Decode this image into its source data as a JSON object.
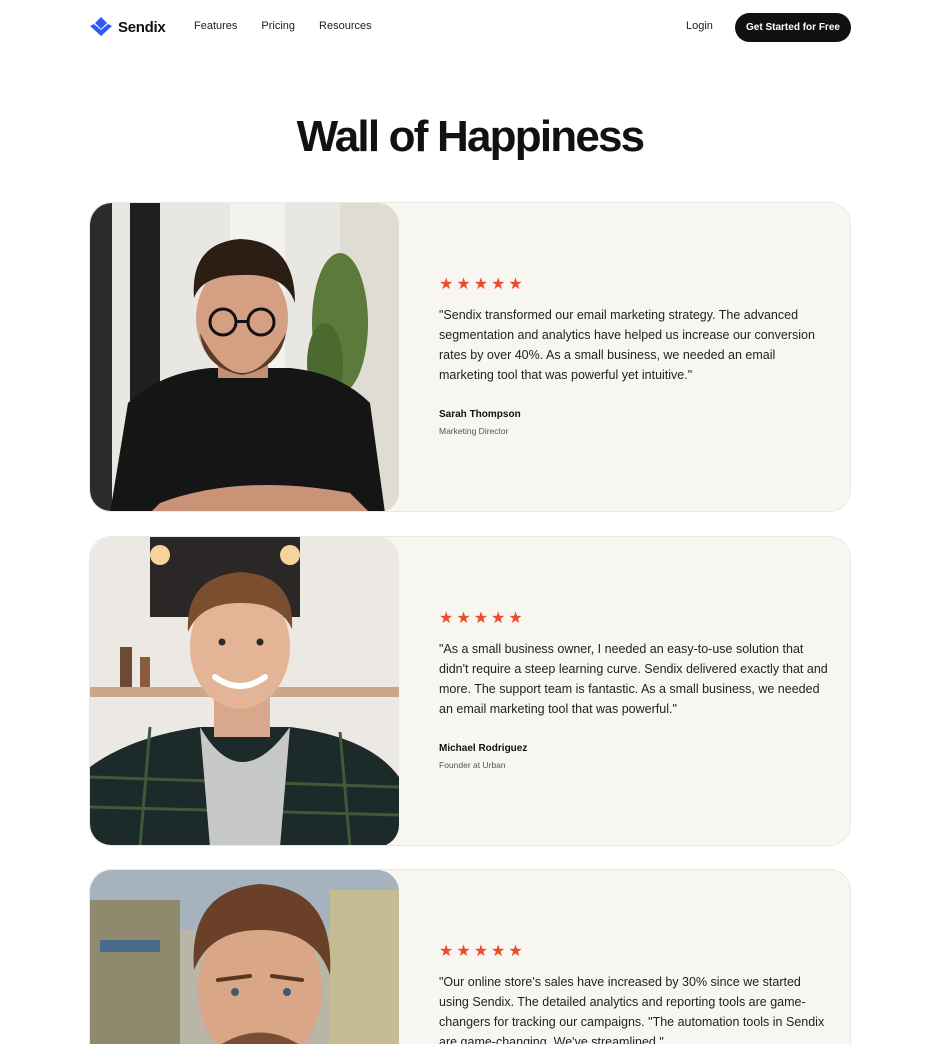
{
  "nav": {
    "brand": "Sendix",
    "links": [
      "Features",
      "Pricing",
      "Resources"
    ],
    "login": "Login",
    "cta": "Get Started for Free"
  },
  "page": {
    "title": "Wall of Happiness"
  },
  "colors": {
    "accent": "#ee4b2b",
    "brand": "#2b5bf2",
    "card_bg": "#f8f6f1",
    "cta_bg": "#111111"
  },
  "testimonials": [
    {
      "rating": 5,
      "quote": "\"Sendix transformed our email marketing strategy. The advanced segmentation and analytics have helped us increase our conversion rates by over 40%. As a small business, we needed an email marketing tool that was powerful yet intuitive.\"",
      "name": "Sarah Thompson",
      "role": "Marketing Director"
    },
    {
      "rating": 5,
      "quote": "\"As a small business owner, I needed an easy-to-use solution that didn't require a steep learning curve. Sendix delivered exactly that and more. The support team is fantastic. As a small business, we needed an email marketing tool that was powerful.\"",
      "name": "Michael Rodriguez",
      "role": "Founder at Urban"
    },
    {
      "rating": 5,
      "quote": "\"Our online store's sales have increased by 30% since we started using Sendix. The detailed analytics and reporting tools are game-changers for tracking our campaigns. \"The automation tools in Sendix are game-changing. We've streamlined.\"",
      "name": "",
      "role": ""
    }
  ]
}
